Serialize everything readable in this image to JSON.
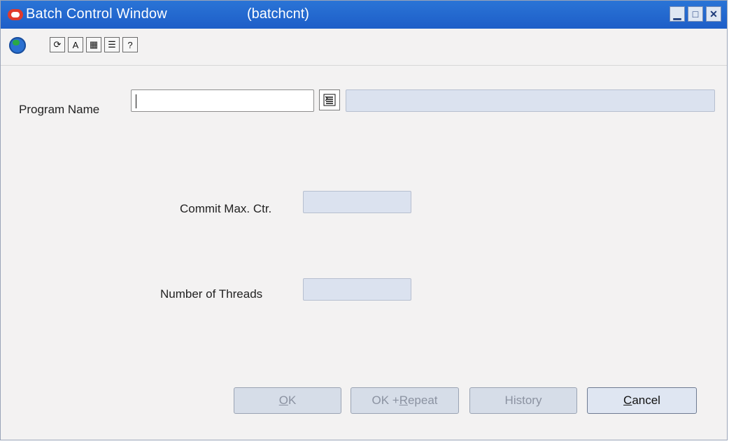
{
  "window": {
    "title": "Batch Control Window",
    "id": "(batchcnt)",
    "controls": {
      "minimize": "▁",
      "maximize": "□",
      "close": "✕"
    }
  },
  "toolbar": {
    "buttons": [
      {
        "name": "globe",
        "icon": "globe-icon"
      },
      {
        "name": "refresh",
        "glyph": "⟳",
        "icon": "refresh-icon"
      },
      {
        "name": "spell",
        "glyph": "A",
        "icon": "spell-icon"
      },
      {
        "name": "calendar",
        "glyph": "▦",
        "icon": "calendar-icon"
      },
      {
        "name": "note",
        "glyph": "☰",
        "icon": "note-icon"
      },
      {
        "name": "help",
        "glyph": "?",
        "icon": "help-icon"
      }
    ]
  },
  "form": {
    "program_name_label": "Program Name",
    "program_name_value": "",
    "program_description_value": "",
    "commit_max_label": "Commit Max. Ctr.",
    "commit_max_value": "",
    "threads_label": "Number of Threads",
    "threads_value": ""
  },
  "buttons": {
    "ok": {
      "prefix": "",
      "mn": "O",
      "rest": "K"
    },
    "ok_repeat": {
      "prefix": "OK + ",
      "mn": "R",
      "rest": "epeat"
    },
    "history": {
      "prefix": "History",
      "mn": "",
      "rest": ""
    },
    "cancel": {
      "prefix": "",
      "mn": "C",
      "rest": "ancel"
    }
  },
  "colors": {
    "titlebar": "#1e5ec8",
    "disabled_field": "#dbe2ef",
    "window_bg": "#f3f2f2"
  }
}
